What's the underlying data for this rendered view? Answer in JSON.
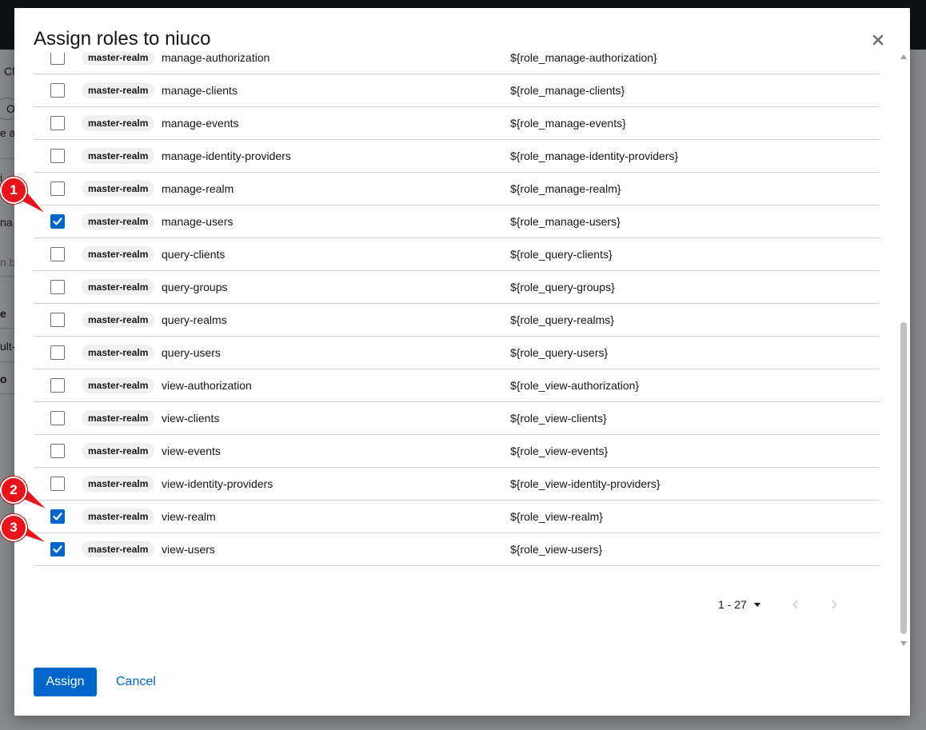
{
  "modal": {
    "title": "Assign roles to niuco"
  },
  "table": {
    "rows": [
      {
        "client": "master-realm",
        "name": "manage-authorization",
        "description": "${role_manage-authorization}",
        "checked": false
      },
      {
        "client": "master-realm",
        "name": "manage-clients",
        "description": "${role_manage-clients}",
        "checked": false
      },
      {
        "client": "master-realm",
        "name": "manage-events",
        "description": "${role_manage-events}",
        "checked": false
      },
      {
        "client": "master-realm",
        "name": "manage-identity-providers",
        "description": "${role_manage-identity-providers}",
        "checked": false
      },
      {
        "client": "master-realm",
        "name": "manage-realm",
        "description": "${role_manage-realm}",
        "checked": false
      },
      {
        "client": "master-realm",
        "name": "manage-users",
        "description": "${role_manage-users}",
        "checked": true
      },
      {
        "client": "master-realm",
        "name": "query-clients",
        "description": "${role_query-clients}",
        "checked": false
      },
      {
        "client": "master-realm",
        "name": "query-groups",
        "description": "${role_query-groups}",
        "checked": false
      },
      {
        "client": "master-realm",
        "name": "query-realms",
        "description": "${role_query-realms}",
        "checked": false
      },
      {
        "client": "master-realm",
        "name": "query-users",
        "description": "${role_query-users}",
        "checked": false
      },
      {
        "client": "master-realm",
        "name": "view-authorization",
        "description": "${role_view-authorization}",
        "checked": false
      },
      {
        "client": "master-realm",
        "name": "view-clients",
        "description": "${role_view-clients}",
        "checked": false
      },
      {
        "client": "master-realm",
        "name": "view-events",
        "description": "${role_view-events}",
        "checked": false
      },
      {
        "client": "master-realm",
        "name": "view-identity-providers",
        "description": "${role_view-identity-providers}",
        "checked": false
      },
      {
        "client": "master-realm",
        "name": "view-realm",
        "description": "${role_view-realm}",
        "checked": true
      },
      {
        "client": "master-realm",
        "name": "view-users",
        "description": "${role_view-users}",
        "checked": true
      }
    ]
  },
  "pagination": {
    "range": "1 - 27"
  },
  "actions": {
    "assign_label": "Assign",
    "cancel_label": "Cancel"
  },
  "annotations": [
    "1",
    "2",
    "3"
  ],
  "background": {
    "fragments": [
      "Cl",
      "O",
      "e a",
      "i",
      "na",
      "n b",
      "e",
      "ult-",
      "o"
    ]
  },
  "colors": {
    "accent": "#0066cc",
    "marker": "#e8141c"
  }
}
